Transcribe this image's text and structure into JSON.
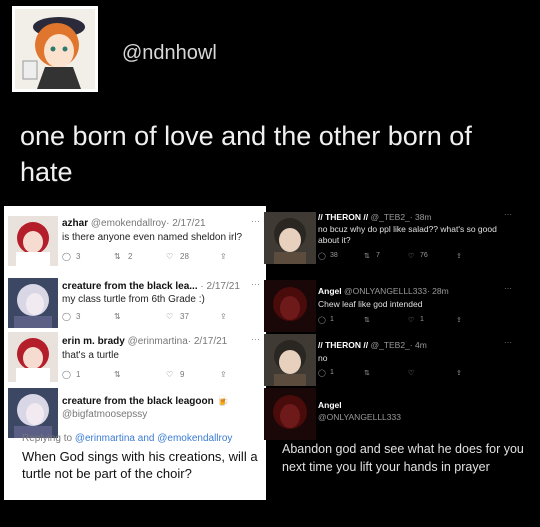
{
  "header": {
    "handle": "@ndnhowl",
    "caption": "one born of love and the other born of hate"
  },
  "left_thread": [
    {
      "name": "azhar",
      "handle": "@emokendallroy",
      "date": "· 2/17/21",
      "text": "is there anyone even named sheldon irl?",
      "replies": "3",
      "retweets": "2",
      "likes": "28"
    },
    {
      "name": "creature from the black lea...",
      "handle": "",
      "date": "· 2/17/21",
      "text": "my class turtle from 6th Grade :)",
      "replies": "3",
      "retweets": "",
      "likes": "37"
    },
    {
      "name": "erin m. brady",
      "handle": "@erinmartina",
      "date": "· 2/17/21",
      "text": "that's a turtle",
      "replies": "1",
      "retweets": "",
      "likes": "9"
    }
  ],
  "reply_tweet": {
    "name": "creature from the black leagoon",
    "emoji": "🍺",
    "handle": "@bigfatmoosepssy",
    "replying_prefix": "Replying to",
    "replying_users": "@erinmartina and @emokendallroy",
    "text": "When God sings with his creations, will a turtle not be part of the choir?"
  },
  "right_thread": [
    {
      "name": "// THERON //",
      "handle": "@_TEB2_",
      "date": "· 38m",
      "text": "no bcuz why do ppl like salad?? what's so good about it?",
      "replies": "38",
      "retweets": "7",
      "likes": "76"
    },
    {
      "name": "Angel",
      "handle": "@ONLYANGELLL333",
      "date": "· 28m",
      "text": "Chew leaf like god intended",
      "replies": "1",
      "retweets": "",
      "likes": "1"
    },
    {
      "name": "// THERON //",
      "handle": "@_TEB2_",
      "date": "· 4m",
      "text": "no",
      "replies": "1",
      "retweets": "",
      "likes": ""
    },
    {
      "name": "Angel",
      "handle": "@ONLYANGELLL333",
      "date": "",
      "text": "",
      "replies": "",
      "retweets": "",
      "likes": ""
    }
  ],
  "right_reply_text": "Abandon god and see what he does for you next time you lift your hands in prayer",
  "icons": {
    "reply": "reply-icon",
    "retweet": "retweet-icon",
    "like": "heart-icon",
    "share": "share-icon",
    "more": "more-icon"
  }
}
